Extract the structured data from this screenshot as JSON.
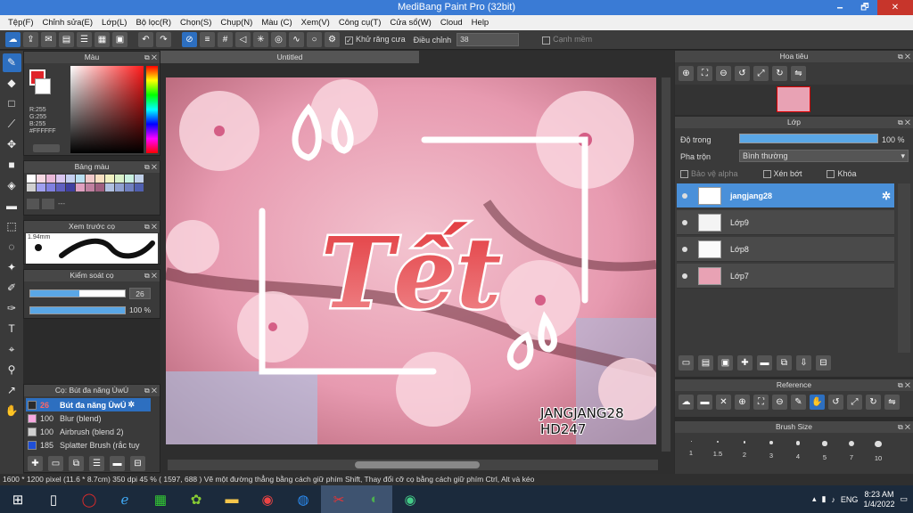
{
  "window": {
    "title": "MediBang Paint Pro (32bit)",
    "min": "🗕",
    "max": "🗗",
    "close": "✕"
  },
  "menu": [
    "Tệp(F)",
    "Chỉnh sửa(E)",
    "Lớp(L)",
    "Bộ lọc(R)",
    "Chọn(S)",
    "Chụp(N)",
    "Màu (C)",
    "Xem(V)",
    "Công cụ(T)",
    "Cửa sổ(W)",
    "Cloud",
    "Help"
  ],
  "toolbar": {
    "antialias_label": "Khử răng cưa",
    "adjust_label": "Điều chỉnh",
    "adjust_value": "38",
    "smooth_label": "Cạnh mềm"
  },
  "color_panel": {
    "title": "Màu",
    "r": "R:255",
    "g": "G:255",
    "b": "B:255",
    "hex": "#FFFFFF",
    "primary": "#e0242a",
    "secondary": "#ffffff"
  },
  "palette_panel": {
    "title": "Bảng màu",
    "more": "---"
  },
  "preview_panel": {
    "title": "Xem trước cọ",
    "size": "1.94mm"
  },
  "brush_control": {
    "title": "Kiểm soát cọ",
    "size": "26",
    "opacity": "100 %"
  },
  "brush_list": {
    "title": "Cọ: Bút đa năng ÙwÚ",
    "items": [
      {
        "size": "26",
        "name": "Bút đa năng ÙwÚ",
        "color": "#2b2b2b",
        "selected": true
      },
      {
        "size": "100",
        "name": "Blur (blend)",
        "color": "#f7a8e0",
        "selected": false
      },
      {
        "size": "100",
        "name": "Airbrush (blend 2)",
        "color": "#d0d0d0",
        "selected": false
      },
      {
        "size": "185",
        "name": "Splatter Brush (rắc tuy",
        "color": "#1f4fd8",
        "selected": false
      }
    ]
  },
  "canvas": {
    "tab": "Untitled",
    "title_text": "Tết",
    "credit1": "JANGJANG28",
    "credit2": "HD247"
  },
  "navigator": {
    "title": "Hoa tiêu"
  },
  "layer_panel": {
    "title": "Lớp",
    "opacity_label": "Độ trong",
    "opacity_value": "100 %",
    "blend_label": "Pha trộn",
    "blend_value": "Bình thường",
    "protect_alpha": "Bảo vệ alpha",
    "clip": "Xén bớt",
    "lock": "Khóa",
    "layers": [
      {
        "name": "jangjang28",
        "selected": true
      },
      {
        "name": "Lớp9",
        "selected": false
      },
      {
        "name": "Lớp8",
        "selected": false
      },
      {
        "name": "Lớp7",
        "selected": false
      }
    ]
  },
  "reference_panel": {
    "title": "Reference"
  },
  "brush_size_panel": {
    "title": "Brush Size",
    "sizes": [
      "1",
      "1.5",
      "2",
      "3",
      "4",
      "5",
      "7",
      "10"
    ]
  },
  "statusbar": {
    "text": "1600 * 1200 pixel  (11.6 * 8.7cm)  350 dpi  45 %  ( 1597, 688 )  Vẽ một đường thẳng bằng cách giữ phím Shift, Thay đổi cỡ cọ bằng cách giữ phím Ctrl, Alt và kéo"
  },
  "taskbar": {
    "lang": "ENG",
    "time": "8:23 AM",
    "date": "1/4/2022"
  }
}
